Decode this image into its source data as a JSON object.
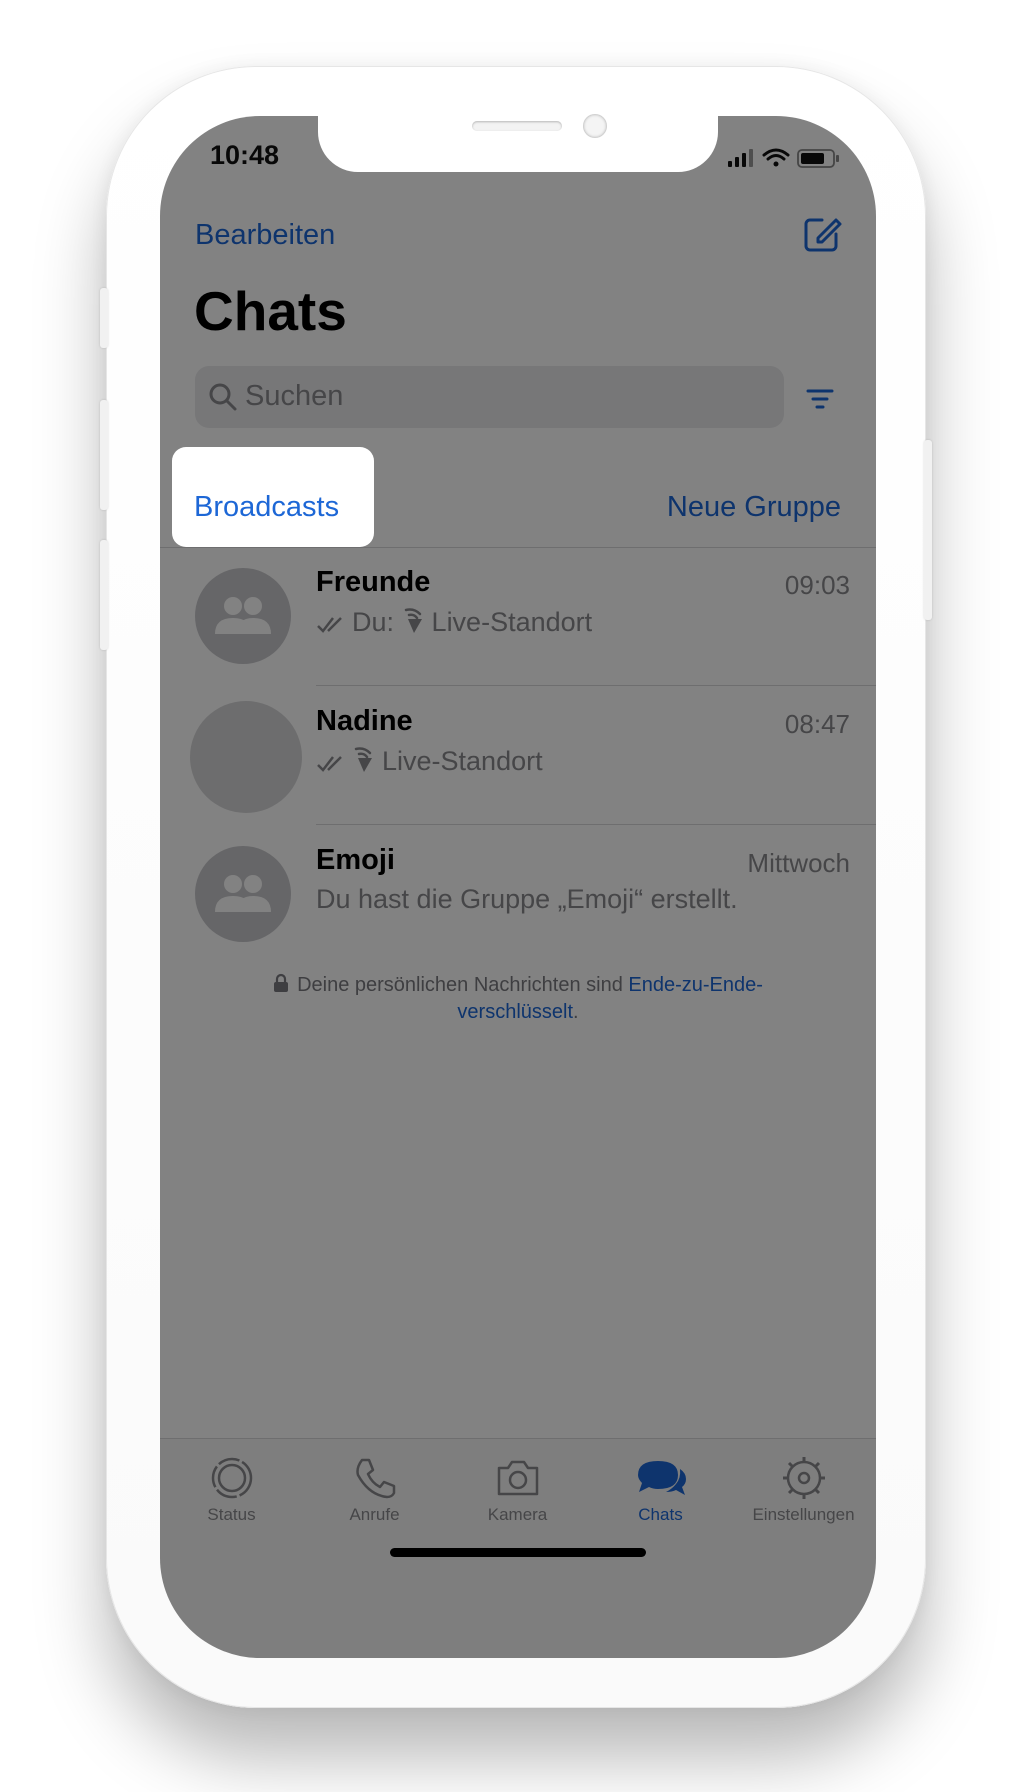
{
  "status_bar": {
    "time": "10:48"
  },
  "nav": {
    "edit_label": "Bearbeiten",
    "title": "Chats"
  },
  "search": {
    "placeholder": "Suchen"
  },
  "links": {
    "broadcasts": "Broadcasts",
    "new_group": "Neue Gruppe"
  },
  "chats": [
    {
      "name": "Freunde",
      "time": "09:03",
      "preview_prefix": "Du:",
      "preview": "Live-Standort",
      "avatar": "group-icon"
    },
    {
      "name": "Nadine",
      "time": "08:47",
      "preview": "Live-Standort",
      "avatar": "placeholder"
    },
    {
      "name": "Emoji",
      "time": "Mittwoch",
      "preview": "Du hast die Gruppe „Emoji“ erstellt.",
      "avatar": "group-icon"
    }
  ],
  "encryption_notice": {
    "text": "Deine persönlichen Nachrichten sind",
    "link": "Ende-zu-Ende-verschlüsselt",
    "end": "."
  },
  "tabs": [
    {
      "label": "Status",
      "icon": "status-icon"
    },
    {
      "label": "Anrufe",
      "icon": "phone-icon"
    },
    {
      "label": "Kamera",
      "icon": "camera-icon"
    },
    {
      "label": "Chats",
      "icon": "chats-icon",
      "active": true
    },
    {
      "label": "Einstellungen",
      "icon": "gear-icon"
    }
  ],
  "colors": {
    "accent": "#1d67d6",
    "overlay": "rgba(0,0,0,0.49)",
    "secondary_text": "#8a8a8e"
  }
}
